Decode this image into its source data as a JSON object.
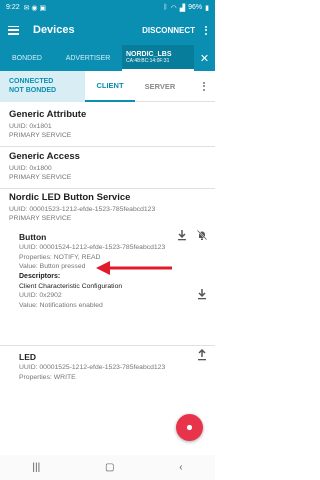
{
  "status_bar": {
    "time": "9:22",
    "battery": "96%"
  },
  "app_bar": {
    "title": "Devices",
    "disconnect_label": "DISCONNECT"
  },
  "device_tabs": {
    "bonded": "BONDED",
    "advertiser": "ADVERTISER",
    "active_name": "NORDIC_LBS",
    "active_address": "CA:48:BC:14:0F:31"
  },
  "connection": {
    "state": "CONNECTED",
    "bond": "NOT BONDED"
  },
  "sub_tabs": {
    "client": "CLIENT",
    "server": "SERVER"
  },
  "services": [
    {
      "name": "Generic Attribute",
      "uuid": "UUID: 0x1801",
      "type": "PRIMARY SERVICE"
    },
    {
      "name": "Generic Access",
      "uuid": "UUID: 0x1800",
      "type": "PRIMARY SERVICE"
    },
    {
      "name": "Nordic LED Button Service",
      "uuid": "UUID: 00001523-1212-efde-1523-785feabcd123",
      "type": "PRIMARY SERVICE"
    }
  ],
  "characteristics": [
    {
      "name": "Button",
      "uuid": "UUID: 00001524-1212-efde-1523-785feabcd123",
      "properties": "Properties: NOTIFY, READ",
      "value": "Value: Button pressed",
      "descriptors_label": "Descriptors:",
      "descriptor": {
        "name": "Client Characteristic Configuration",
        "uuid": "UUID: 0x2902",
        "value": "Value: Notifications enabled"
      }
    },
    {
      "name": "LED",
      "uuid": "UUID: 00001525-1212-efde-1523-785feabcd123",
      "properties": "Properties: WRITE"
    }
  ],
  "colors": {
    "primary": "#0a8fb2",
    "fab": "#e8344a",
    "arrow": "#e21b2b"
  },
  "icons": {
    "download": "download-icon",
    "notify": "notifications-off-icon",
    "upload": "upload-icon",
    "fab": "record-icon"
  }
}
